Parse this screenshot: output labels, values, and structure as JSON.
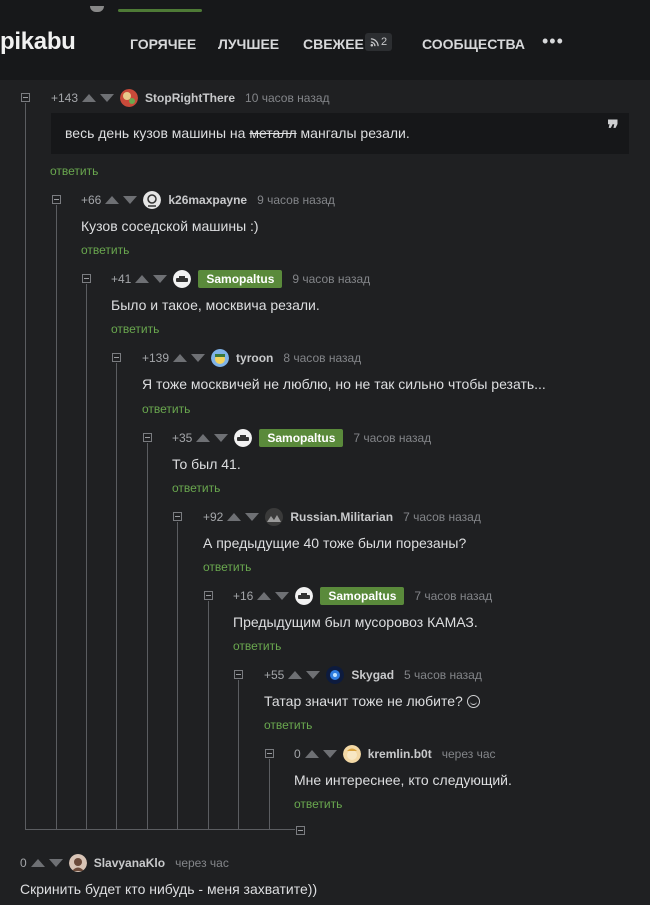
{
  "header": {
    "logo": "pikabu",
    "nav": [
      "ГОРЯЧЕЕ",
      "ЛУЧШЕЕ",
      "СВЕЖЕЕ",
      "СООБЩЕСТВА"
    ],
    "fresh_count": "2",
    "more": "•••"
  },
  "reply_label": "ответить",
  "comments": [
    {
      "rating": "+143",
      "author": "StopRightThere",
      "time": "10 часов назад",
      "text_before": "весь день кузов машины на ",
      "text_strike": "металл",
      "text_after": " мангалы резали."
    },
    {
      "rating": "+66",
      "author": "k26maxpayne",
      "time": "9 часов назад",
      "text": "Кузов соседской машины :)"
    },
    {
      "rating": "+41",
      "author": "Samopaltus",
      "time": "9 часов назад",
      "text": "Было и такое, москвича резали."
    },
    {
      "rating": "+139",
      "author": "tyroon",
      "time": "8 часов назад",
      "text": "Я тоже москвичей не люблю, но не так сильно чтобы резать..."
    },
    {
      "rating": "+35",
      "author": "Samopaltus",
      "time": "7 часов назад",
      "text": "То был 41."
    },
    {
      "rating": "+92",
      "author": "Russian.Militarian",
      "time": "7 часов назад",
      "text": "А предыдущие 40 тоже были порезаны?"
    },
    {
      "rating": "+16",
      "author": "Samopaltus",
      "time": "7 часов назад",
      "text": "Предыдущим был мусоровоз КАМАЗ."
    },
    {
      "rating": "+55",
      "author": "Skygad",
      "time": "5 часов назад",
      "text": "Татар значит тоже не любите? "
    },
    {
      "rating": "0",
      "author": "kremlin.b0t",
      "time": "через час",
      "text": "Мне интереснее, кто следующий."
    },
    {
      "rating": "0",
      "author": "SlavyanaKlo",
      "time": "через час",
      "text": "Скринить будет кто нибудь - меня захватите))"
    }
  ],
  "colors": {
    "background": "#1f2022",
    "header": "#17181a",
    "accent": "#6aa84f",
    "badge": "#5a8a3b"
  }
}
